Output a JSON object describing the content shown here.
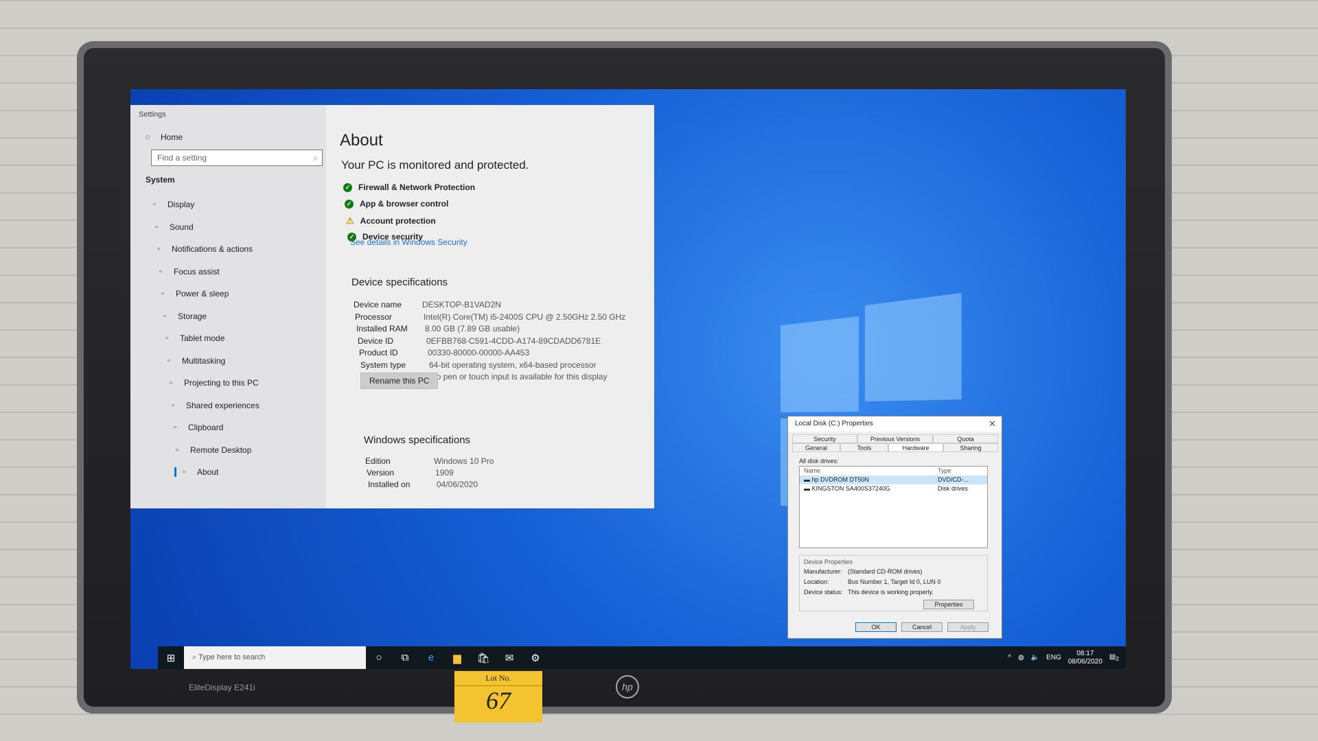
{
  "settings": {
    "window_title": "Settings",
    "home": "Home",
    "search_placeholder": "Find a setting",
    "section": "System",
    "nav": [
      {
        "label": "Display",
        "icon": "display-icon"
      },
      {
        "label": "Sound",
        "icon": "sound-icon"
      },
      {
        "label": "Notifications & actions",
        "icon": "notifications-icon"
      },
      {
        "label": "Focus assist",
        "icon": "moon-icon"
      },
      {
        "label": "Power & sleep",
        "icon": "power-icon"
      },
      {
        "label": "Storage",
        "icon": "storage-icon"
      },
      {
        "label": "Tablet mode",
        "icon": "tablet-icon"
      },
      {
        "label": "Multitasking",
        "icon": "multitasking-icon"
      },
      {
        "label": "Projecting to this PC",
        "icon": "projecting-icon"
      },
      {
        "label": "Shared experiences",
        "icon": "shared-icon"
      },
      {
        "label": "Clipboard",
        "icon": "clipboard-icon"
      },
      {
        "label": "Remote Desktop",
        "icon": "remote-icon"
      },
      {
        "label": "About",
        "icon": "info-icon"
      }
    ],
    "title": "About",
    "protection_heading": "Your PC is monitored and protected.",
    "protection": [
      {
        "label": "Firewall & Network Protection",
        "status": "ok"
      },
      {
        "label": "App & browser control",
        "status": "ok"
      },
      {
        "label": "Account protection",
        "status": "warning"
      },
      {
        "label": "Device security",
        "status": "ok"
      }
    ],
    "security_link": "See details in Windows Security",
    "device_heading": "Device specifications",
    "device_specs": [
      {
        "k": "Device name",
        "v": "DESKTOP-B1VAD2N"
      },
      {
        "k": "Processor",
        "v": "Intel(R) Core(TM) i5-2400S CPU @ 2.50GHz   2.50 GHz"
      },
      {
        "k": "Installed RAM",
        "v": "8.00 GB (7.89 GB usable)"
      },
      {
        "k": "Device ID",
        "v": "0EFBB768-C591-4CDD-A174-89CDADD6781E"
      },
      {
        "k": "Product ID",
        "v": "00330-80000-00000-AA453"
      },
      {
        "k": "System type",
        "v": "64-bit operating system, x64-based processor"
      },
      {
        "k": "Pen and touch",
        "v": "No pen or touch input is available for this display"
      }
    ],
    "rename_button": "Rename this PC",
    "windows_heading": "Windows specifications",
    "windows_specs": [
      {
        "k": "Edition",
        "v": "Windows 10 Pro"
      },
      {
        "k": "Version",
        "v": "1909"
      },
      {
        "k": "Installed on",
        "v": "04/06/2020"
      }
    ]
  },
  "dialog": {
    "title": "Local Disk (C:) Properties",
    "tabs_row1": [
      "Security",
      "Previous Versions",
      "Quota"
    ],
    "tabs_row2": [
      "General",
      "Tools",
      "Hardware",
      "Sharing"
    ],
    "selected_tab": "Hardware",
    "list_label": "All disk drives:",
    "col_name": "Name",
    "col_type": "Type",
    "drives": [
      {
        "name": "hp DVDROM DT50N",
        "type": "DVD/CD-..."
      },
      {
        "name": "KINGSTON SA400S37240G",
        "type": "Disk drives"
      }
    ],
    "group_label": "Device Properties",
    "props": [
      {
        "k": "Manufacturer:",
        "v": "(Standard CD-ROM drives)"
      },
      {
        "k": "Location:",
        "v": "Bus Number 1, Target Id 0, LUN 0"
      },
      {
        "k": "Device status:",
        "v": "This device is working properly."
      }
    ],
    "properties_button": "Properties",
    "ok": "OK",
    "cancel": "Cancel",
    "apply": "Apply"
  },
  "taskbar": {
    "search_placeholder": "Type here to search",
    "lang": "ENG",
    "time": "08:17",
    "date": "08/06/2020",
    "notification_count": "2"
  },
  "monitor": {
    "model": "EliteDisplay E241i",
    "brand_logo": "hp"
  },
  "lot_tag": {
    "label": "Lot No.",
    "number": "67"
  }
}
